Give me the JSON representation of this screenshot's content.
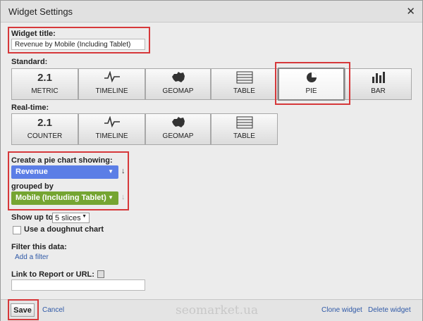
{
  "window": {
    "title": "Widget Settings",
    "close_glyph": "✕"
  },
  "widget_title": {
    "label": "Widget title:",
    "value": "Revenue by Mobile (Including Tablet)"
  },
  "standard": {
    "label": "Standard:",
    "tiles": [
      {
        "icon_text": "2.1",
        "icon": "metric-icon",
        "label": "METRIC"
      },
      {
        "icon_text": "",
        "icon": "timeline-icon",
        "label": "TIMELINE"
      },
      {
        "icon_text": "",
        "icon": "geomap-icon",
        "label": "GEOMAP"
      },
      {
        "icon_text": "",
        "icon": "table-icon",
        "label": "TABLE"
      },
      {
        "icon_text": "",
        "icon": "pie-icon",
        "label": "PIE",
        "selected": true
      },
      {
        "icon_text": "",
        "icon": "bar-icon",
        "label": "BAR"
      }
    ]
  },
  "realtime": {
    "label": "Real-time:",
    "tiles": [
      {
        "icon_text": "2.1",
        "icon": "counter-icon",
        "label": "COUNTER"
      },
      {
        "icon_text": "",
        "icon": "timeline-icon",
        "label": "TIMELINE"
      },
      {
        "icon_text": "",
        "icon": "geomap-icon",
        "label": "GEOMAP"
      },
      {
        "icon_text": "",
        "icon": "table-icon",
        "label": "TABLE"
      }
    ]
  },
  "pie": {
    "showing_label": "Create a pie chart showing:",
    "metric": "Revenue",
    "metric_color": "#5b7ee6",
    "grouped_label": "grouped by",
    "dimension": "Mobile (Including Tablet)",
    "dimension_color": "#75a532"
  },
  "show_up_to": {
    "label": "Show up to",
    "value": "5 slices"
  },
  "doughnut": {
    "label": "Use a doughnut chart",
    "checked": false
  },
  "filter": {
    "label": "Filter this data:",
    "add_link": "Add a filter"
  },
  "link_report": {
    "label": "Link to Report or URL:",
    "value": ""
  },
  "footer": {
    "save": "Save",
    "cancel": "Cancel",
    "watermark": "seomarket.ua",
    "clone": "Clone widget",
    "delete": "Delete widget"
  }
}
